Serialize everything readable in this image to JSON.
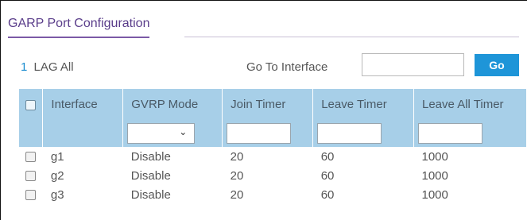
{
  "panel": {
    "title": "GARP Port Configuration"
  },
  "nav": {
    "page_number": "1",
    "lag_label": "LAG",
    "all_label": "All"
  },
  "goto": {
    "label": "Go To Interface",
    "input_value": "",
    "button_label": "Go"
  },
  "table": {
    "columns": [
      "Interface",
      "GVRP Mode",
      "Join Timer",
      "Leave Timer",
      "Leave All Timer"
    ],
    "filter": {
      "gvrp_mode": "",
      "join_timer": "",
      "leave_timer": "",
      "leave_all_timer": ""
    },
    "rows": [
      {
        "interface": "g1",
        "gvrp_mode": "Disable",
        "join_timer": "20",
        "leave_timer": "60",
        "leave_all_timer": "1000"
      },
      {
        "interface": "g2",
        "gvrp_mode": "Disable",
        "join_timer": "20",
        "leave_timer": "60",
        "leave_all_timer": "1000"
      },
      {
        "interface": "g3",
        "gvrp_mode": "Disable",
        "join_timer": "20",
        "leave_timer": "60",
        "leave_all_timer": "1000"
      }
    ]
  },
  "icons": {
    "dropdown": "chevron-down-icon"
  },
  "colors": {
    "header_bg": "#a7cfe8",
    "accent": "#1e95d8",
    "title": "#5a3d8a"
  }
}
